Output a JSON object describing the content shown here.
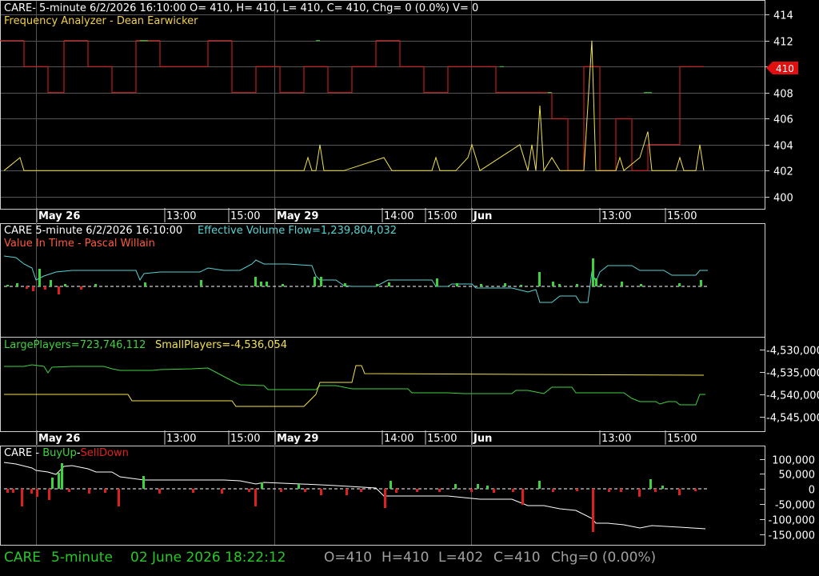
{
  "panel1": {
    "header": "CARE- 5-minute 6/2/2026 16:10:00 O= 410, H= 410, L= 410, C= 410, Chg= 0 (0.0%) V= 0",
    "indicator": "Frequency Analyzer - Dean Earwicker",
    "price_marker": "410"
  },
  "panel2": {
    "symbol": "CARE 5-minute  6/2/2026 16:10:00",
    "evf": "Effective Volume Flow=1,239,804,032",
    "indicator": "Value In Time - Pascal Willain"
  },
  "panel3": {
    "large": "LargePlayers=723,746,112",
    "small": "SmallPlayers=-4,536,054"
  },
  "panel4": {
    "symbol": "CARE - ",
    "buyup": "BuyUp",
    "dash": "-",
    "selldown": "SellDown"
  },
  "dates_top": [
    "May 26",
    "13:00",
    "15:00",
    "May 29",
    "14:00",
    "15:00",
    "Jun",
    "13:00",
    "15:00"
  ],
  "dates_bottom": [
    "May 26",
    "13:00",
    "15:00",
    "May 29",
    "14:00",
    "15:00",
    "Jun",
    "13:00",
    "15:00"
  ],
  "status": {
    "symbol": "CARE",
    "interval": "5-minute",
    "datetime": "02 June 2026 18:22:12",
    "o": "O=410",
    "h": "H=410",
    "l": "L=402",
    "c": "C=410",
    "chg": "Chg=0 (0.00%)"
  },
  "colors": {
    "up": "#3fd23f",
    "down": "#e02020",
    "yellow": "#f2e250",
    "cyan": "#58d2d2",
    "grid": "#555555",
    "status_green": "#28c828",
    "status_gray": "#a0a0a0"
  },
  "chart_data": [
    {
      "type": "line",
      "title": "Frequency Analyzer - Dean Earwicker",
      "ylim": [
        399,
        415
      ],
      "y_ticks": [
        400,
        402,
        404,
        406,
        408,
        410,
        412,
        414
      ],
      "price_lines": [
        {
          "color": "red",
          "segments": [
            [
              0,
              30,
              412
            ],
            [
              30,
              60,
              410
            ],
            [
              60,
              80,
              408
            ],
            [
              80,
              110,
              412
            ],
            [
              110,
              140,
              410
            ],
            [
              140,
              170,
              408
            ],
            [
              170,
              200,
              412
            ],
            [
              200,
              230,
              410
            ],
            [
              230,
              260,
              410
            ],
            [
              260,
              290,
              412
            ],
            [
              290,
              320,
              408
            ],
            [
              320,
              350,
              410
            ],
            [
              350,
              380,
              408
            ],
            [
              380,
              410,
              410
            ],
            [
              410,
              440,
              408
            ],
            [
              440,
              470,
              410
            ],
            [
              470,
              500,
              412
            ],
            [
              500,
              530,
              410
            ],
            [
              530,
              560,
              408
            ],
            [
              560,
              590,
              410
            ],
            [
              590,
              620,
              410
            ],
            [
              620,
              650,
              408
            ],
            [
              650,
              670,
              408
            ],
            [
              670,
              690,
              408
            ],
            [
              690,
              710,
              406
            ],
            [
              710,
              730,
              402
            ],
            [
              730,
              750,
              410
            ],
            [
              750,
              770,
              402
            ],
            [
              770,
              790,
              406
            ],
            [
              790,
              810,
              402
            ],
            [
              810,
              830,
              404
            ],
            [
              830,
              850,
              404
            ],
            [
              850,
              880,
              410
            ]
          ]
        },
        {
          "color": "green",
          "segments": [
            [
              175,
              185,
              412
            ],
            [
              395,
              400,
              412
            ],
            [
              625,
              630,
              410
            ],
            [
              685,
              690,
              408
            ],
            [
              805,
              815,
              408
            ]
          ]
        }
      ],
      "frequency_line": [
        [
          5,
          402
        ],
        [
          25,
          403
        ],
        [
          30,
          402
        ],
        [
          60,
          402
        ],
        [
          80,
          402
        ],
        [
          100,
          402
        ],
        [
          150,
          402
        ],
        [
          200,
          402
        ],
        [
          250,
          402
        ],
        [
          300,
          402
        ],
        [
          340,
          402
        ],
        [
          380,
          402
        ],
        [
          385,
          403
        ],
        [
          390,
          402
        ],
        [
          395,
          402
        ],
        [
          400,
          404
        ],
        [
          405,
          402
        ],
        [
          430,
          402
        ],
        [
          480,
          403
        ],
        [
          490,
          402
        ],
        [
          540,
          402
        ],
        [
          545,
          403
        ],
        [
          550,
          402
        ],
        [
          570,
          402
        ],
        [
          585,
          403
        ],
        [
          590,
          404
        ],
        [
          600,
          402
        ],
        [
          650,
          404
        ],
        [
          660,
          402
        ],
        [
          665,
          404
        ],
        [
          670,
          402
        ],
        [
          675,
          407
        ],
        [
          680,
          402
        ],
        [
          690,
          403
        ],
        [
          700,
          402
        ],
        [
          730,
          402
        ],
        [
          740,
          412
        ],
        [
          745,
          402
        ],
        [
          770,
          402
        ],
        [
          775,
          403
        ],
        [
          780,
          402
        ],
        [
          800,
          403
        ],
        [
          810,
          405
        ],
        [
          815,
          402
        ],
        [
          845,
          402
        ],
        [
          850,
          403
        ],
        [
          855,
          402
        ],
        [
          870,
          402
        ],
        [
          875,
          404
        ],
        [
          880,
          402
        ]
      ]
    },
    {
      "type": "line",
      "title": "Value In Time - Pascal Willain",
      "series": [
        {
          "name": "Effective Volume Flow",
          "color": "cyan"
        },
        {
          "name": "Value In Time",
          "color": "bars"
        }
      ]
    },
    {
      "type": "line",
      "y_ticks": [
        "4,530,000",
        "4,535,000",
        "4,540,000",
        "4,545,000"
      ],
      "ylim": [
        -4547000,
        -4528000
      ],
      "series": [
        {
          "name": "LargePlayers",
          "values_label": "723,746,112"
        },
        {
          "name": "SmallPlayers",
          "values_label": "-4,536,054"
        }
      ]
    },
    {
      "type": "bar",
      "title": "CARE - BuyUp-SellDown",
      "ylim": [
        -160000,
        115000
      ],
      "y_ticks": [
        "100,000",
        "50,000",
        "0",
        "-50,000",
        "-100,000",
        "-150,000"
      ]
    }
  ]
}
